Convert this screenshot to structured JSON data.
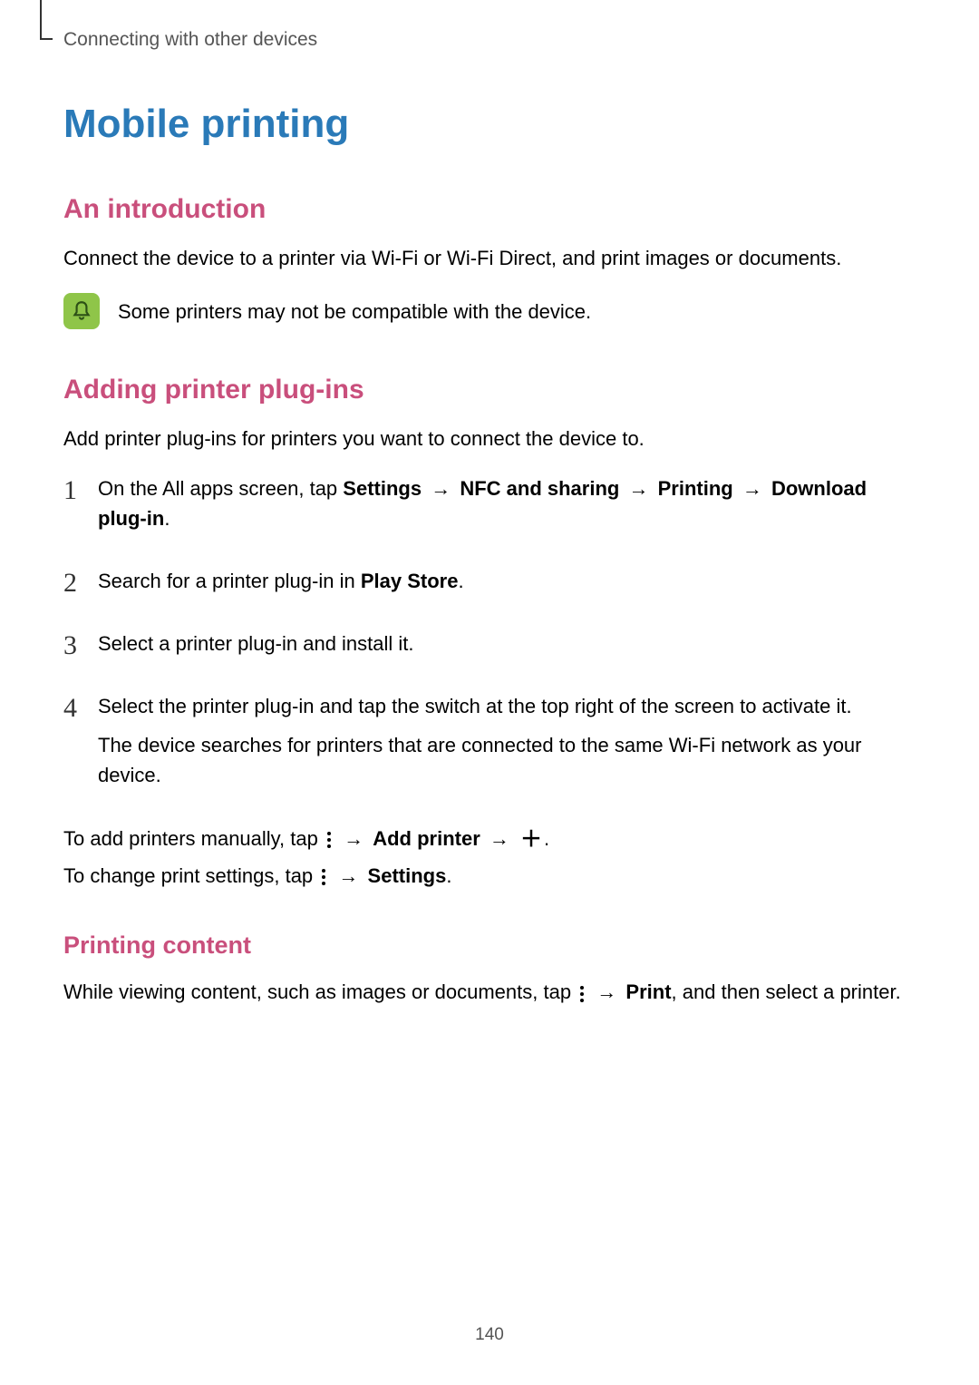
{
  "breadcrumb": "Connecting with other devices",
  "title": "Mobile printing",
  "intro": {
    "heading": "An introduction",
    "body": "Connect the device to a printer via Wi-Fi or Wi-Fi Direct, and print images or documents.",
    "note": "Some printers may not be compatible with the device."
  },
  "plugins": {
    "heading": "Adding printer plug-ins",
    "body": "Add printer plug-ins for printers you want to connect the device to.",
    "steps": {
      "s1_prefix": "On the All apps screen, tap ",
      "s1_settings": "Settings",
      "s1_nfc": "NFC and sharing",
      "s1_printing": "Printing",
      "s1_download": "Download plug-in",
      "s2_prefix": "Search for a printer plug-in in ",
      "s2_playstore": "Play Store",
      "s3": "Select a printer plug-in and install it.",
      "s4_line1": "Select the printer plug-in and tap the switch at the top right of the screen to activate it.",
      "s4_line2": "The device searches for printers that are connected to the same Wi-Fi network as your device."
    },
    "manual_prefix": "To add printers manually, tap ",
    "manual_addprinter": "Add printer",
    "settings_prefix": "To change print settings, tap ",
    "settings_label": "Settings"
  },
  "printing": {
    "heading": "Printing content",
    "body_prefix": "While viewing content, such as images or documents, tap ",
    "print_label": "Print",
    "body_suffix": ", and then select a printer."
  },
  "arrow": "→",
  "page_number": "140"
}
